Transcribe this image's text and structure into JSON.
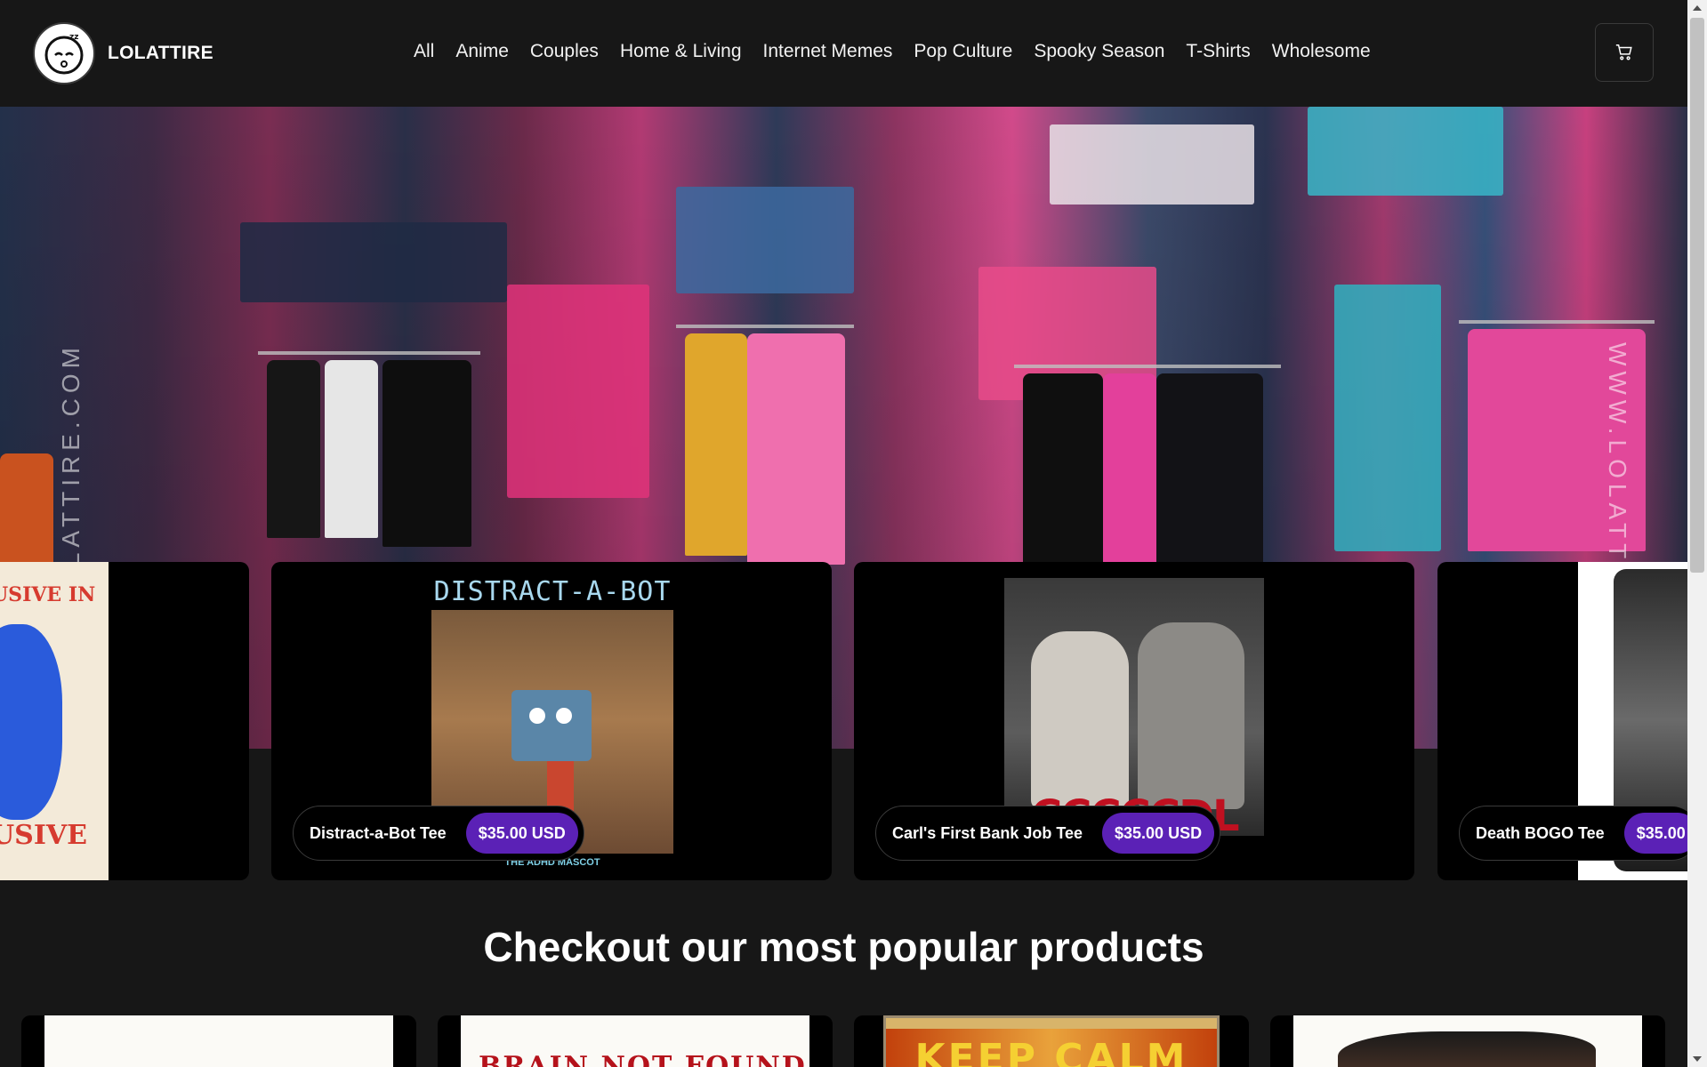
{
  "brand": {
    "name": "LOLATTIRE",
    "logo_icon": "sleepy-face-logo-icon"
  },
  "nav": {
    "items": [
      "All",
      "Anime",
      "Couples",
      "Home & Living",
      "Internet Memes",
      "Pop Culture",
      "Spooky Season",
      "T-Shirts",
      "Wholesome"
    ]
  },
  "cart": {
    "icon": "shopping-cart-icon"
  },
  "hero": {
    "left_watermark": "WWW.LOLATTIRE.COM",
    "right_watermark": "WWW.LOLATTIRE.C"
  },
  "carousel": {
    "items": [
      {
        "art_text_top": "USIVE IN",
        "art_text_bottom": "USIVE"
      },
      {
        "title": "Distract-a-Bot Tee",
        "price": "$35.00 USD",
        "art_heading": "DISTRACT-A-BOT",
        "art_caption": "THE ADHD MASCOT"
      },
      {
        "title": "Carl's First Bank Job Tee",
        "price": "$35.00 USD",
        "art_heading": "CCCCCDL"
      },
      {
        "title": "Death BOGO Tee",
        "price": "$35.00"
      }
    ]
  },
  "popular": {
    "heading": "Checkout our most popular products",
    "items": [
      {
        "art_text": ""
      },
      {
        "art_text": "BRAIN NOT FOUND"
      },
      {
        "art_text": "KEEP CALM"
      },
      {
        "art_text": ""
      }
    ]
  },
  "colors": {
    "background": "#171717",
    "accent": "#5b21b6",
    "card": "#000000"
  }
}
